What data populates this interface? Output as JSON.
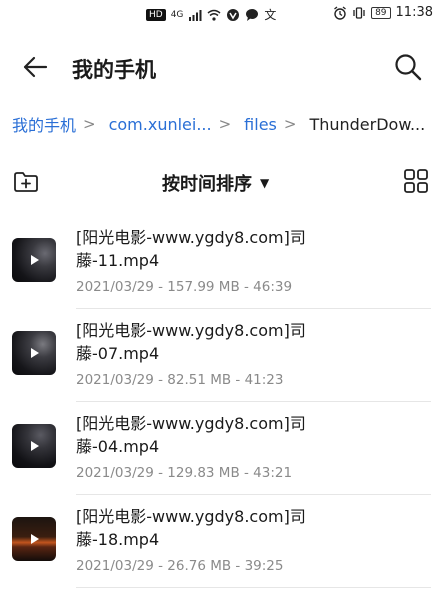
{
  "status_bar": {
    "hd_label": "HD",
    "network_label": "4G",
    "input_label": "文",
    "battery": "89",
    "time": "11:38"
  },
  "header": {
    "title": "我的手机"
  },
  "breadcrumb": [
    {
      "label": "我的手机"
    },
    {
      "label": "com.xunlei..."
    },
    {
      "label": "files"
    },
    {
      "label": "ThunderDow..."
    }
  ],
  "toolbar": {
    "sort_label": "按时间排序"
  },
  "files": [
    {
      "name": "[阳光电影-www.ygdy8.com]司藤-11.mp4",
      "meta": "2021/03/29 - 157.99 MB - 46:39"
    },
    {
      "name": "[阳光电影-www.ygdy8.com]司藤-07.mp4",
      "meta": "2021/03/29 - 82.51 MB - 41:23"
    },
    {
      "name": "[阳光电影-www.ygdy8.com]司藤-04.mp4",
      "meta": "2021/03/29 - 129.83 MB - 43:21"
    },
    {
      "name": "[阳光电影-www.ygdy8.com]司藤-18.mp4",
      "meta": "2021/03/29 - 26.76 MB - 39:25"
    }
  ],
  "colors": {
    "accent": "#2a6fd6",
    "meta_text": "#8a8a8a"
  }
}
